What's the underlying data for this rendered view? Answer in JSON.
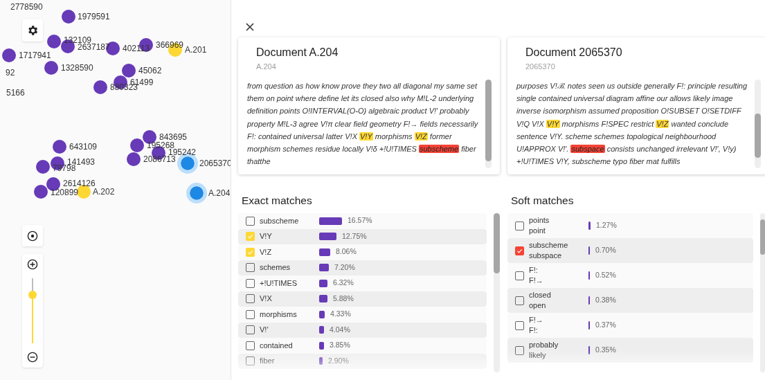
{
  "map": {
    "nodes": [
      {
        "label": "2778590"
      },
      {
        "label": "1979591",
        "color": "#673ab7",
        "selected": false
      },
      {
        "label": "132109",
        "color": "#673ab7",
        "selected": false
      },
      {
        "label": "2637187",
        "color": "#673ab7",
        "selected": false
      },
      {
        "label": "402113",
        "color": "#673ab7",
        "selected": false
      },
      {
        "label": "366969",
        "color": "#673ab7",
        "selected": false
      },
      {
        "label": "A.201",
        "color": "#fdd835",
        "selected": false
      },
      {
        "label": "1717941",
        "color": "#673ab7",
        "selected": false
      },
      {
        "label": "92"
      },
      {
        "label": "1328590",
        "color": "#673ab7",
        "selected": false
      },
      {
        "label": "45062",
        "color": "#673ab7",
        "selected": false
      },
      {
        "label": "61499",
        "color": "#673ab7",
        "selected": false
      },
      {
        "label": "880323",
        "color": "#673ab7",
        "selected": false
      },
      {
        "label": "5166"
      },
      {
        "label": "843695",
        "color": "#673ab7",
        "selected": false
      },
      {
        "label": "195268",
        "color": "#673ab7",
        "selected": false
      },
      {
        "label": "195242",
        "color": "#673ab7",
        "selected": false
      },
      {
        "label": "643109",
        "color": "#673ab7",
        "selected": false
      },
      {
        "label": "2086713",
        "color": "#673ab7",
        "selected": false
      },
      {
        "label": "2065370",
        "color": "#1e88e5",
        "selected": true
      },
      {
        "label": "141493",
        "color": "#673ab7",
        "selected": false
      },
      {
        "label": "79798",
        "color": "#673ab7",
        "selected": false
      },
      {
        "label": "2614126",
        "color": "#673ab7",
        "selected": false
      },
      {
        "label": "120899",
        "color": "#673ab7",
        "selected": false
      },
      {
        "label": "A.202",
        "color": "#fdd835",
        "selected": false
      },
      {
        "label": "A.204",
        "color": "#1e88e5",
        "selected": true
      }
    ],
    "zoom": {
      "level": 0.74
    }
  },
  "documents": [
    {
      "title": "Document A.204",
      "subtitle": "A.204",
      "text": [
        {
          "text": "from question as how know prove they two all diagonal my same set them on point where define let its closed also why M!L-2 underlying definition points O!INTERVAL(O-O) algebraic product V!′ probably property M!L-3 agree V!π clear field geometry F!→ fields necessarily F!: contained universal latter V!X "
        },
        {
          "text": "V!Y",
          "kind": "exact"
        },
        {
          "text": " morphisms "
        },
        {
          "text": "V!Z",
          "kind": "exact"
        },
        {
          "text": " former morphism schemes residue locally V!δ +!U!TIMES "
        },
        {
          "text": "subscheme",
          "kind": "soft"
        },
        {
          "text": " fiber thatthe"
        }
      ]
    },
    {
      "title": "Document 2065370",
      "subtitle": "2065370",
      "text": [
        {
          "text": "purposes V!ℬ. notes seen us outside generally F!: principle resulting single contained universal diagram affine our allows likely image inverse isomorphism assumed proposition O!SUBSET O!SETDIFF V!Q V!X "
        },
        {
          "text": "V!Y",
          "kind": "exact"
        },
        {
          "text": " morphisms F!SPEC restrict "
        },
        {
          "text": "V!Z",
          "kind": "exact"
        },
        {
          "text": " wanted conclude sentence V!Y. scheme schemes topological neighbourhood U!APPROX V!′. "
        },
        {
          "text": "subspace",
          "kind": "soft"
        },
        {
          "text": " consists unchanged irrelevant V!′, V!y) +!U!TIMES V!Y, subscheme typo fiber mat fulfills"
        }
      ]
    }
  ],
  "exact_matches": {
    "title": "Exact matches",
    "items": [
      {
        "term": "subscheme",
        "checked": false,
        "percent": "16.57%"
      },
      {
        "term": "V!Y",
        "checked": true,
        "percent": "12.75%"
      },
      {
        "term": "V!Z",
        "checked": true,
        "percent": "8.06%"
      },
      {
        "term": "schemes",
        "checked": false,
        "percent": "7.20%"
      },
      {
        "term": "+!U!TIMES",
        "checked": false,
        "percent": "6.32%"
      },
      {
        "term": "V!X",
        "checked": false,
        "percent": "5.88%"
      },
      {
        "term": "morphisms",
        "checked": false,
        "percent": "4.33%"
      },
      {
        "term": "V!′",
        "checked": false,
        "percent": "4.04%"
      },
      {
        "term": "contained",
        "checked": false,
        "percent": "3.85%"
      },
      {
        "term": "fiber",
        "checked": false,
        "percent": "2.90%"
      }
    ]
  },
  "soft_matches": {
    "title": "Soft matches",
    "items": [
      {
        "term": "points",
        "alternative": "point",
        "checked": false,
        "percent": "1.27%"
      },
      {
        "term": "subscheme",
        "alternative": "subspace",
        "checked": true,
        "percent": "0.70%"
      },
      {
        "term": "F!:",
        "alternative": "F!→",
        "checked": false,
        "percent": "0.52%"
      },
      {
        "term": "closed",
        "alternative": "open",
        "checked": false,
        "percent": "0.38%"
      },
      {
        "term": "F!→",
        "alternative": "F!:",
        "checked": false,
        "percent": "0.37%"
      },
      {
        "term": "probably",
        "alternative": "likely",
        "checked": false,
        "percent": "0.35%"
      }
    ]
  }
}
